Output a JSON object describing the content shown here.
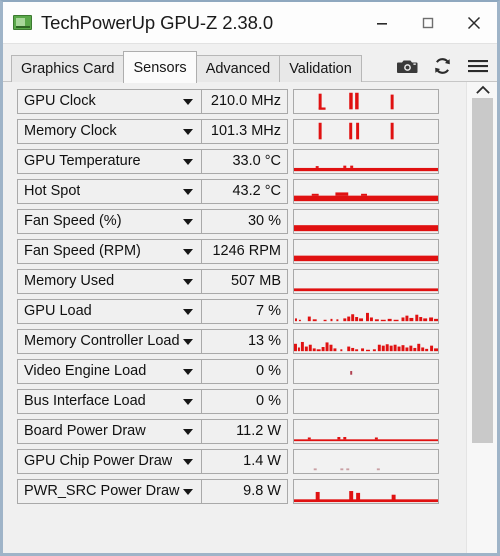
{
  "window": {
    "title": "TechPowerUp GPU-Z 2.38.0",
    "app_icon": "graphics-card-icon",
    "controls": {
      "minimize": "minimize-icon",
      "maximize": "maximize-icon",
      "close": "close-icon"
    }
  },
  "tabs": [
    {
      "label": "Graphics Card",
      "active": false
    },
    {
      "label": "Sensors",
      "active": true
    },
    {
      "label": "Advanced",
      "active": false
    },
    {
      "label": "Validation",
      "active": false
    }
  ],
  "toolbar": [
    {
      "icon": "camera-icon",
      "label": "Screenshot"
    },
    {
      "icon": "refresh-icon",
      "label": "Refresh"
    },
    {
      "icon": "hamburger-menu-icon",
      "label": "Menu"
    }
  ],
  "colors": {
    "graph_line": "#e01111",
    "window_border": "#9fb4c8",
    "panel_background": "#f0f0f0",
    "active_tab": "#fbfbfb",
    "scrollbar_thumb": "#c9c9c9"
  },
  "sensors": [
    {
      "name": "GPU Clock",
      "value": "210.0 MHz",
      "graph": "spikes_a"
    },
    {
      "name": "Memory Clock",
      "value": "101.3 MHz",
      "graph": "spikes_b"
    },
    {
      "name": "GPU Temperature",
      "value": "33.0 °C",
      "graph": "flat_low"
    },
    {
      "name": "Hot Spot",
      "value": "43.2 °C",
      "graph": "flat_bumpy"
    },
    {
      "name": "Fan Speed (%)",
      "value": "30 %",
      "graph": "flat_solid"
    },
    {
      "name": "Fan Speed (RPM)",
      "value": "1246 RPM",
      "graph": "flat_solid"
    },
    {
      "name": "Memory Used",
      "value": "507 MB",
      "graph": "flat_thin"
    },
    {
      "name": "GPU Load",
      "value": "7 %",
      "graph": "noisy_light"
    },
    {
      "name": "Memory Controller Load",
      "value": "13 %",
      "graph": "noisy_dense"
    },
    {
      "name": "Video Engine Load",
      "value": "0 %",
      "graph": "single_dot"
    },
    {
      "name": "Bus Interface Load",
      "value": "0 %",
      "graph": "empty"
    },
    {
      "name": "Board Power Draw",
      "value": "11.2 W",
      "graph": "baseline_dots"
    },
    {
      "name": "GPU Chip Power Draw",
      "value": "1.4 W",
      "graph": "faint_dots"
    },
    {
      "name": "PWR_SRC Power Draw",
      "value": "9.8 W",
      "graph": "baseline_spikes"
    }
  ],
  "scrollbar": {
    "up_arrow": "chevron-up-icon",
    "thumb_top_pct": 0,
    "thumb_height_pct": 74
  }
}
